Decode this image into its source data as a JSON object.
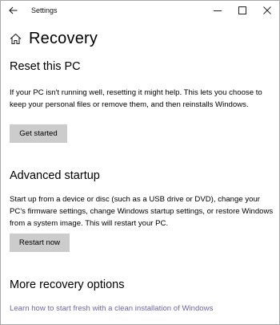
{
  "window": {
    "title": "Settings",
    "back_icon": "arrow-left-icon",
    "minimize_icon": "minimize-icon",
    "maximize_icon": "maximize-icon",
    "close_icon": "close-icon"
  },
  "page": {
    "icon": "home-icon",
    "title": "Recovery"
  },
  "reset": {
    "heading": "Reset this PC",
    "description": "If your PC isn't running well, resetting it might help. This lets you choose to keep your personal files or remove them, and then reinstalls Windows.",
    "button_label": "Get started"
  },
  "advanced": {
    "heading": "Advanced startup",
    "description": "Start up from a device or disc (such as a USB drive or DVD), change your PC's firmware settings, change Windows startup settings, or restore Windows from a system image. This will restart your PC.",
    "button_label": "Restart now"
  },
  "more": {
    "heading": "More recovery options",
    "link_text": "Learn how to start fresh with a clean installation of Windows"
  },
  "colors": {
    "button_bg": "#cccccc",
    "link": "#6b67a8"
  }
}
